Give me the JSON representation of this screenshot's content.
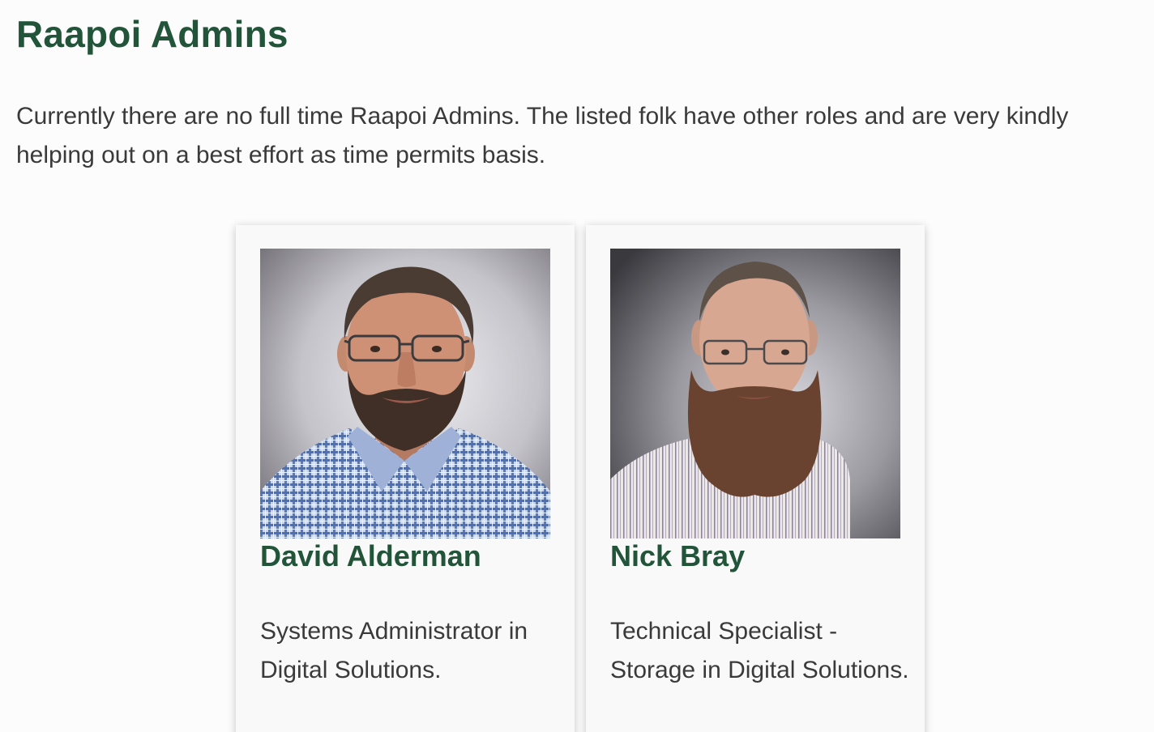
{
  "page": {
    "title": "Raapoi Admins",
    "intro": "Currently there are no full time Raapoi Admins. The listed folk have other roles and are very kindly helping out on a best effort as time permits basis."
  },
  "admins": [
    {
      "name": "David Alderman",
      "role": "Systems Administrator in Digital Solutions.",
      "photo_icon": "portrait-photo"
    },
    {
      "name": "Nick Bray",
      "role": "Technical Specialist - Storage in Digital Solutions.",
      "photo_icon": "portrait-photo"
    }
  ],
  "colors": {
    "heading": "#22543a",
    "text": "#3a3a3a",
    "background": "#fcfcfc",
    "card": "#f9f9f9"
  }
}
